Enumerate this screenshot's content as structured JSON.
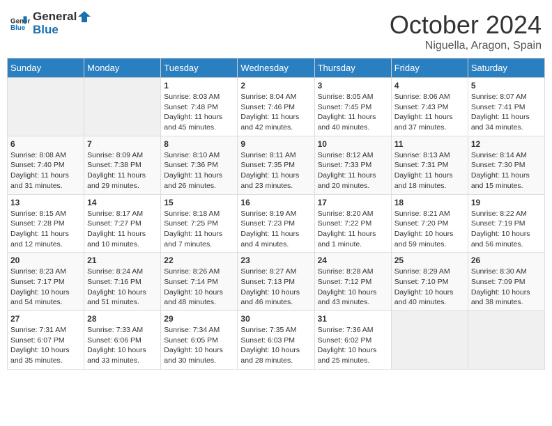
{
  "header": {
    "logo_general": "General",
    "logo_blue": "Blue",
    "month_year": "October 2024",
    "location": "Niguella, Aragon, Spain"
  },
  "days_of_week": [
    "Sunday",
    "Monday",
    "Tuesday",
    "Wednesday",
    "Thursday",
    "Friday",
    "Saturday"
  ],
  "weeks": [
    [
      {
        "day": "",
        "info": ""
      },
      {
        "day": "",
        "info": ""
      },
      {
        "day": "1",
        "info": "Sunrise: 8:03 AM\nSunset: 7:48 PM\nDaylight: 11 hours and 45 minutes."
      },
      {
        "day": "2",
        "info": "Sunrise: 8:04 AM\nSunset: 7:46 PM\nDaylight: 11 hours and 42 minutes."
      },
      {
        "day": "3",
        "info": "Sunrise: 8:05 AM\nSunset: 7:45 PM\nDaylight: 11 hours and 40 minutes."
      },
      {
        "day": "4",
        "info": "Sunrise: 8:06 AM\nSunset: 7:43 PM\nDaylight: 11 hours and 37 minutes."
      },
      {
        "day": "5",
        "info": "Sunrise: 8:07 AM\nSunset: 7:41 PM\nDaylight: 11 hours and 34 minutes."
      }
    ],
    [
      {
        "day": "6",
        "info": "Sunrise: 8:08 AM\nSunset: 7:40 PM\nDaylight: 11 hours and 31 minutes."
      },
      {
        "day": "7",
        "info": "Sunrise: 8:09 AM\nSunset: 7:38 PM\nDaylight: 11 hours and 29 minutes."
      },
      {
        "day": "8",
        "info": "Sunrise: 8:10 AM\nSunset: 7:36 PM\nDaylight: 11 hours and 26 minutes."
      },
      {
        "day": "9",
        "info": "Sunrise: 8:11 AM\nSunset: 7:35 PM\nDaylight: 11 hours and 23 minutes."
      },
      {
        "day": "10",
        "info": "Sunrise: 8:12 AM\nSunset: 7:33 PM\nDaylight: 11 hours and 20 minutes."
      },
      {
        "day": "11",
        "info": "Sunrise: 8:13 AM\nSunset: 7:31 PM\nDaylight: 11 hours and 18 minutes."
      },
      {
        "day": "12",
        "info": "Sunrise: 8:14 AM\nSunset: 7:30 PM\nDaylight: 11 hours and 15 minutes."
      }
    ],
    [
      {
        "day": "13",
        "info": "Sunrise: 8:15 AM\nSunset: 7:28 PM\nDaylight: 11 hours and 12 minutes."
      },
      {
        "day": "14",
        "info": "Sunrise: 8:17 AM\nSunset: 7:27 PM\nDaylight: 11 hours and 10 minutes."
      },
      {
        "day": "15",
        "info": "Sunrise: 8:18 AM\nSunset: 7:25 PM\nDaylight: 11 hours and 7 minutes."
      },
      {
        "day": "16",
        "info": "Sunrise: 8:19 AM\nSunset: 7:23 PM\nDaylight: 11 hours and 4 minutes."
      },
      {
        "day": "17",
        "info": "Sunrise: 8:20 AM\nSunset: 7:22 PM\nDaylight: 11 hours and 1 minute."
      },
      {
        "day": "18",
        "info": "Sunrise: 8:21 AM\nSunset: 7:20 PM\nDaylight: 10 hours and 59 minutes."
      },
      {
        "day": "19",
        "info": "Sunrise: 8:22 AM\nSunset: 7:19 PM\nDaylight: 10 hours and 56 minutes."
      }
    ],
    [
      {
        "day": "20",
        "info": "Sunrise: 8:23 AM\nSunset: 7:17 PM\nDaylight: 10 hours and 54 minutes."
      },
      {
        "day": "21",
        "info": "Sunrise: 8:24 AM\nSunset: 7:16 PM\nDaylight: 10 hours and 51 minutes."
      },
      {
        "day": "22",
        "info": "Sunrise: 8:26 AM\nSunset: 7:14 PM\nDaylight: 10 hours and 48 minutes."
      },
      {
        "day": "23",
        "info": "Sunrise: 8:27 AM\nSunset: 7:13 PM\nDaylight: 10 hours and 46 minutes."
      },
      {
        "day": "24",
        "info": "Sunrise: 8:28 AM\nSunset: 7:12 PM\nDaylight: 10 hours and 43 minutes."
      },
      {
        "day": "25",
        "info": "Sunrise: 8:29 AM\nSunset: 7:10 PM\nDaylight: 10 hours and 40 minutes."
      },
      {
        "day": "26",
        "info": "Sunrise: 8:30 AM\nSunset: 7:09 PM\nDaylight: 10 hours and 38 minutes."
      }
    ],
    [
      {
        "day": "27",
        "info": "Sunrise: 7:31 AM\nSunset: 6:07 PM\nDaylight: 10 hours and 35 minutes."
      },
      {
        "day": "28",
        "info": "Sunrise: 7:33 AM\nSunset: 6:06 PM\nDaylight: 10 hours and 33 minutes."
      },
      {
        "day": "29",
        "info": "Sunrise: 7:34 AM\nSunset: 6:05 PM\nDaylight: 10 hours and 30 minutes."
      },
      {
        "day": "30",
        "info": "Sunrise: 7:35 AM\nSunset: 6:03 PM\nDaylight: 10 hours and 28 minutes."
      },
      {
        "day": "31",
        "info": "Sunrise: 7:36 AM\nSunset: 6:02 PM\nDaylight: 10 hours and 25 minutes."
      },
      {
        "day": "",
        "info": ""
      },
      {
        "day": "",
        "info": ""
      }
    ]
  ]
}
